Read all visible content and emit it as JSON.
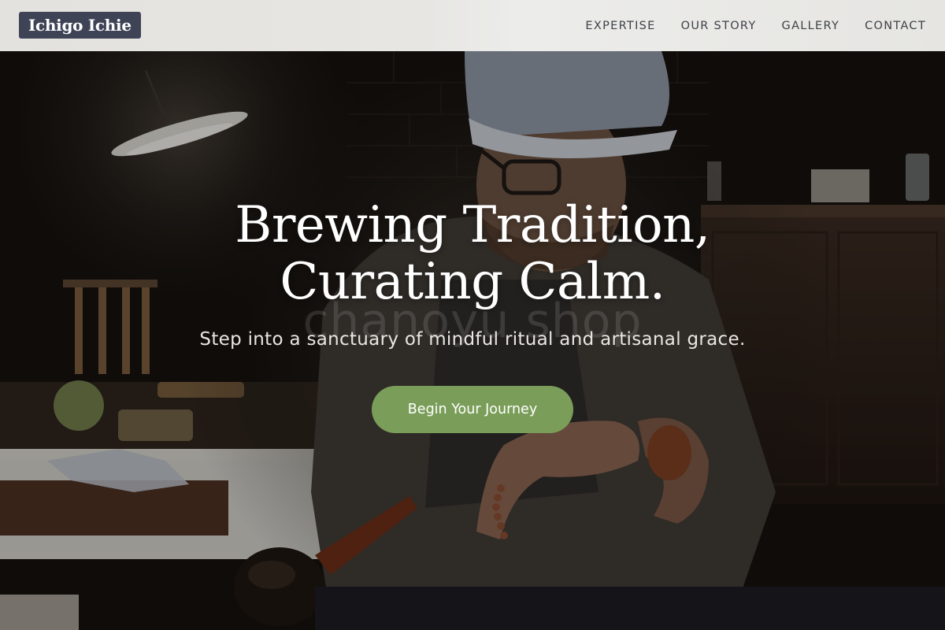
{
  "header": {
    "logo_text": "Ichigo Ichie",
    "nav": [
      {
        "label": "EXPERTISE"
      },
      {
        "label": "OUR STORY"
      },
      {
        "label": "GALLERY"
      },
      {
        "label": "CONTACT"
      }
    ]
  },
  "hero": {
    "headline_line1": "Brewing Tradition,",
    "headline_line2": "Curating Calm.",
    "watermark": "chanoyu shop",
    "subheadline": "Step into a sanctuary of mindful ritual and artisanal grace.",
    "cta_label": "Begin Your Journey",
    "background_image": "artisan-crafting-pipe-photo"
  },
  "colors": {
    "header_bg": "#e6e5e2",
    "logo_bg": "#3e4356",
    "nav_text": "#3f4147",
    "cta_bg": "#7a9e59",
    "hero_text": "#ffffff"
  }
}
